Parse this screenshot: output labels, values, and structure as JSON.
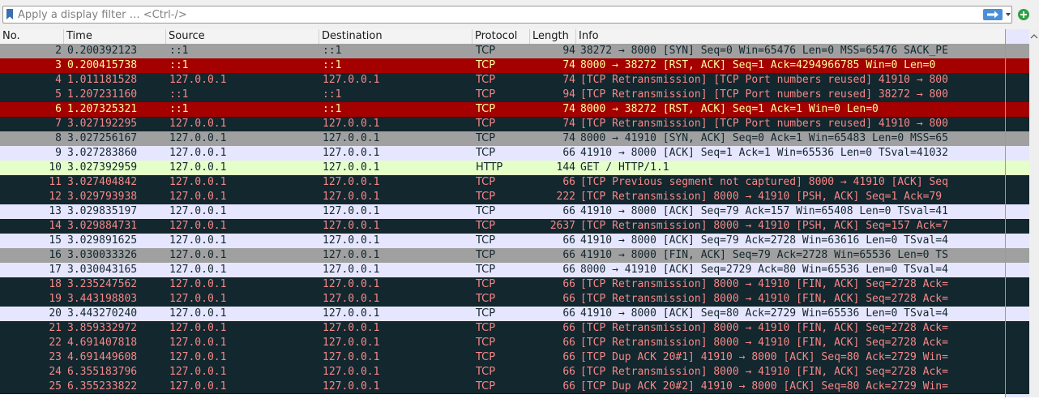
{
  "filter": {
    "placeholder": "Apply a display filter … <Ctrl-/>",
    "value": ""
  },
  "icons": {
    "bookmark": "bookmark-icon",
    "apply": "arrow-right-icon",
    "dropdown": "chevron-down-icon",
    "add": "plus-circle-icon",
    "scroll_up": "chevron-up-icon"
  },
  "colors": {
    "gray": "#a0a0a0",
    "red": "#a40000",
    "dark": "#12272e",
    "lavender": "#e7e6ff",
    "green": "#e4ffc7"
  },
  "columns": {
    "no": "No.",
    "time": "Time",
    "source": "Source",
    "destination": "Destination",
    "protocol": "Protocol",
    "length": "Length",
    "info": "Info"
  },
  "packets": [
    {
      "no": "2",
      "time": "0.200392123",
      "src": "::1",
      "dst": "::1",
      "proto": "TCP",
      "len": "94",
      "info": "38272 → 8000 [SYN] Seq=0 Win=65476 Len=0 MSS=65476 SACK_PE",
      "style": "gray"
    },
    {
      "no": "3",
      "time": "0.200415738",
      "src": "::1",
      "dst": "::1",
      "proto": "TCP",
      "len": "74",
      "info": "8000 → 38272 [RST, ACK] Seq=1 Ack=4294966785 Win=0 Len=0",
      "style": "red"
    },
    {
      "no": "4",
      "time": "1.011181528",
      "src": "127.0.0.1",
      "dst": "127.0.0.1",
      "proto": "TCP",
      "len": "74",
      "info": "[TCP Retransmission] [TCP Port numbers reused] 41910 → 800",
      "style": "dark"
    },
    {
      "no": "5",
      "time": "1.207231160",
      "src": "::1",
      "dst": "::1",
      "proto": "TCP",
      "len": "94",
      "info": "[TCP Retransmission] [TCP Port numbers reused] 38272 → 800",
      "style": "dark"
    },
    {
      "no": "6",
      "time": "1.207325321",
      "src": "::1",
      "dst": "::1",
      "proto": "TCP",
      "len": "74",
      "info": "8000 → 38272 [RST, ACK] Seq=1 Ack=1 Win=0 Len=0",
      "style": "red"
    },
    {
      "no": "7",
      "time": "3.027192295",
      "src": "127.0.0.1",
      "dst": "127.0.0.1",
      "proto": "TCP",
      "len": "74",
      "info": "[TCP Retransmission] [TCP Port numbers reused] 41910 → 800",
      "style": "dark"
    },
    {
      "no": "8",
      "time": "3.027256167",
      "src": "127.0.0.1",
      "dst": "127.0.0.1",
      "proto": "TCP",
      "len": "74",
      "info": "8000 → 41910 [SYN, ACK] Seq=0 Ack=1 Win=65483 Len=0 MSS=65",
      "style": "gray"
    },
    {
      "no": "9",
      "time": "3.027283860",
      "src": "127.0.0.1",
      "dst": "127.0.0.1",
      "proto": "TCP",
      "len": "66",
      "info": "41910 → 8000 [ACK] Seq=1 Ack=1 Win=65536 Len=0 TSval=41032",
      "style": "lav"
    },
    {
      "no": "10",
      "time": "3.027392959",
      "src": "127.0.0.1",
      "dst": "127.0.0.1",
      "proto": "HTTP",
      "len": "144",
      "info": "GET / HTTP/1.1",
      "style": "green"
    },
    {
      "no": "11",
      "time": "3.027404842",
      "src": "127.0.0.1",
      "dst": "127.0.0.1",
      "proto": "TCP",
      "len": "66",
      "info": "[TCP Previous segment not captured] 8000 → 41910 [ACK] Seq",
      "style": "dark"
    },
    {
      "no": "12",
      "time": "3.029793938",
      "src": "127.0.0.1",
      "dst": "127.0.0.1",
      "proto": "TCP",
      "len": "222",
      "info": "[TCP Retransmission] 8000 → 41910 [PSH, ACK] Seq=1 Ack=79",
      "style": "dark"
    },
    {
      "no": "13",
      "time": "3.029835197",
      "src": "127.0.0.1",
      "dst": "127.0.0.1",
      "proto": "TCP",
      "len": "66",
      "info": "41910 → 8000 [ACK] Seq=79 Ack=157 Win=65408 Len=0 TSval=41",
      "style": "lav"
    },
    {
      "no": "14",
      "time": "3.029884731",
      "src": "127.0.0.1",
      "dst": "127.0.0.1",
      "proto": "TCP",
      "len": "2637",
      "info": "[TCP Retransmission] 8000 → 41910 [PSH, ACK] Seq=157 Ack=7",
      "style": "dark"
    },
    {
      "no": "15",
      "time": "3.029891625",
      "src": "127.0.0.1",
      "dst": "127.0.0.1",
      "proto": "TCP",
      "len": "66",
      "info": "41910 → 8000 [ACK] Seq=79 Ack=2728 Win=63616 Len=0 TSval=4",
      "style": "lav"
    },
    {
      "no": "16",
      "time": "3.030033326",
      "src": "127.0.0.1",
      "dst": "127.0.0.1",
      "proto": "TCP",
      "len": "66",
      "info": "41910 → 8000 [FIN, ACK] Seq=79 Ack=2728 Win=65536 Len=0 TS",
      "style": "gray"
    },
    {
      "no": "17",
      "time": "3.030043165",
      "src": "127.0.0.1",
      "dst": "127.0.0.1",
      "proto": "TCP",
      "len": "66",
      "info": "8000 → 41910 [ACK] Seq=2729 Ack=80 Win=65536 Len=0 TSval=4",
      "style": "lav"
    },
    {
      "no": "18",
      "time": "3.235247562",
      "src": "127.0.0.1",
      "dst": "127.0.0.1",
      "proto": "TCP",
      "len": "66",
      "info": "[TCP Retransmission] 8000 → 41910 [FIN, ACK] Seq=2728 Ack=",
      "style": "dark"
    },
    {
      "no": "19",
      "time": "3.443198803",
      "src": "127.0.0.1",
      "dst": "127.0.0.1",
      "proto": "TCP",
      "len": "66",
      "info": "[TCP Retransmission] 8000 → 41910 [FIN, ACK] Seq=2728 Ack=",
      "style": "dark"
    },
    {
      "no": "20",
      "time": "3.443270240",
      "src": "127.0.0.1",
      "dst": "127.0.0.1",
      "proto": "TCP",
      "len": "66",
      "info": "41910 → 8000 [ACK] Seq=80 Ack=2729 Win=65536 Len=0 TSval=4",
      "style": "lav"
    },
    {
      "no": "21",
      "time": "3.859332972",
      "src": "127.0.0.1",
      "dst": "127.0.0.1",
      "proto": "TCP",
      "len": "66",
      "info": "[TCP Retransmission] 8000 → 41910 [FIN, ACK] Seq=2728 Ack=",
      "style": "dark"
    },
    {
      "no": "22",
      "time": "4.691407818",
      "src": "127.0.0.1",
      "dst": "127.0.0.1",
      "proto": "TCP",
      "len": "66",
      "info": "[TCP Retransmission] 8000 → 41910 [FIN, ACK] Seq=2728 Ack=",
      "style": "dark"
    },
    {
      "no": "23",
      "time": "4.691449608",
      "src": "127.0.0.1",
      "dst": "127.0.0.1",
      "proto": "TCP",
      "len": "66",
      "info": "[TCP Dup ACK 20#1] 41910 → 8000 [ACK] Seq=80 Ack=2729 Win=",
      "style": "dark"
    },
    {
      "no": "24",
      "time": "6.355183796",
      "src": "127.0.0.1",
      "dst": "127.0.0.1",
      "proto": "TCP",
      "len": "66",
      "info": "[TCP Retransmission] 8000 → 41910 [FIN, ACK] Seq=2728 Ack=",
      "style": "dark"
    },
    {
      "no": "25",
      "time": "6.355233822",
      "src": "127.0.0.1",
      "dst": "127.0.0.1",
      "proto": "TCP",
      "len": "66",
      "info": "[TCP Dup ACK 20#2] 41910 → 8000 [ACK] Seq=80 Ack=2729 Win=",
      "style": "dark"
    }
  ]
}
